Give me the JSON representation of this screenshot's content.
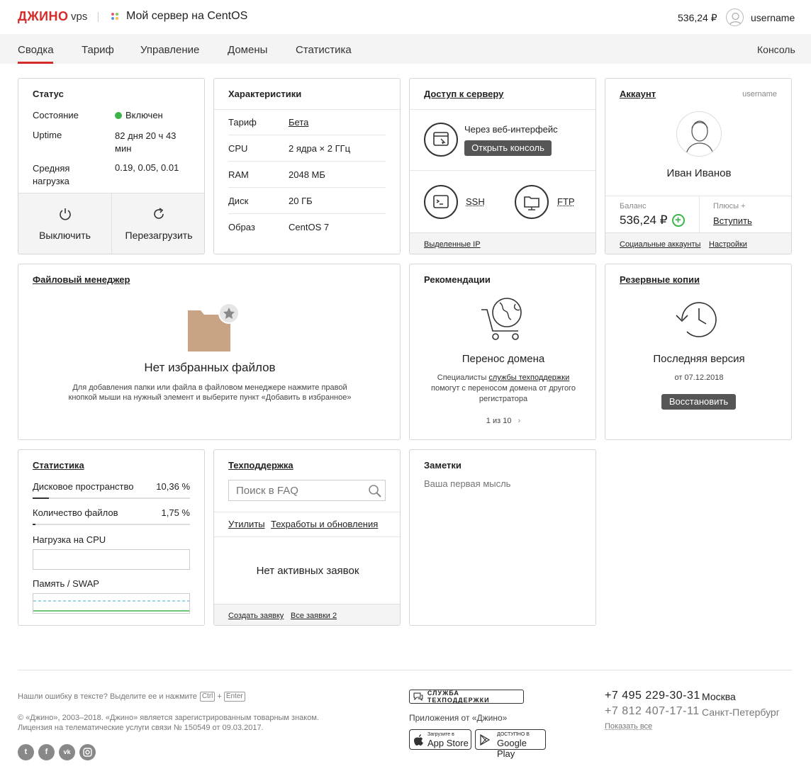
{
  "header": {
    "logo": "ДЖИНО",
    "product": "vps",
    "server_title": "Мой сервер на CentOS",
    "balance": "536,24 ₽",
    "username": "username"
  },
  "nav": {
    "tabs": [
      "Сводка",
      "Тариф",
      "Управление",
      "Домены",
      "Статистика"
    ],
    "console": "Консоль"
  },
  "status": {
    "title": "Статус",
    "state_label": "Состояние",
    "state_value": "Включен",
    "uptime_label": "Uptime",
    "uptime_value": "82 дня 20 ч 43 мин",
    "load_label": "Средняя нагрузка",
    "load_value": "0.19, 0.05, 0.01",
    "off_button": "Выключить",
    "reboot_button": "Перезагрузить",
    "state_color": "#3bb54a"
  },
  "specs": {
    "title": "Характеристики",
    "rows": [
      {
        "label": "Тариф",
        "value": "Бета"
      },
      {
        "label": "CPU",
        "value": "2 ядра × 2 ГГц"
      },
      {
        "label": "RAM",
        "value": "2048 МБ"
      },
      {
        "label": "Диск",
        "value": "20 ГБ"
      },
      {
        "label": "Образ",
        "value": "CentOS 7"
      }
    ]
  },
  "access": {
    "title": "Доступ к серверу",
    "web_label": "Через веб-интерфейс",
    "console_button": "Открыть консоль",
    "ssh": "SSH",
    "ftp": "FTP",
    "ips": "Выделенные IP"
  },
  "account": {
    "title": "Аккаунт",
    "username": "username",
    "name": "Иван Иванов",
    "balance_label": "Баланс",
    "balance_value": "536,24 ₽",
    "plus_label": "Плюсы +",
    "join": "Вступить",
    "social": "Социальные аккаунты",
    "settings": "Настройки"
  },
  "files": {
    "title": "Файловый менеджер",
    "empty_title": "Нет избранных файлов",
    "empty_text_1": "Для добавления папки или файла в файловом менеджере нажмите правой",
    "empty_text_2": "кнопкой мыши на нужный элемент и выберите пункт «Добавить в избранное»"
  },
  "recommend": {
    "title": "Рекомендации",
    "heading": "Перенос домена",
    "text_1": "Специалисты",
    "text_link": "службы техподдержки",
    "text_2": "помогут с переносом домена от другого",
    "text_3": "регистратора",
    "pager": "1 из 10"
  },
  "backup": {
    "title": "Резервные копии",
    "heading": "Последняя версия",
    "date": "от 07.12.2018",
    "restore": "Восстановить"
  },
  "stats": {
    "title": "Статистика",
    "disk_label": "Дисковое пространство",
    "disk_value": "10,36 %",
    "disk_fraction": 0.1036,
    "files_label": "Количество файлов",
    "files_value": "1,75 %",
    "files_fraction": 0.0175,
    "cpu_label": "Нагрузка на CPU",
    "mem_label": "Память / SWAP"
  },
  "support": {
    "title": "Техподдержка",
    "search_placeholder": "Поиск в FAQ",
    "utils": "Утилиты",
    "maintenance": "Техработы и обновления",
    "empty": "Нет активных заявок",
    "create": "Создать заявку",
    "all": "Все заявки 2"
  },
  "notes": {
    "title": "Заметки",
    "placeholder": "Ваша первая мысль"
  },
  "footer": {
    "error_text": "Нашли ошибку в тексте? Выделите ее и нажмите",
    "key_ctrl": "Ctrl",
    "plus": "+",
    "key_enter": "Enter",
    "copyright_1": "© «Джино», 2003–2018. «Джино» является зарегистрированным товарным знаком.",
    "copyright_2": "Лицензия на телематические услуги связи № 150549 от 09.03.2017.",
    "support_badge": "СЛУЖБА ТЕХПОДДЕРЖКИ",
    "apps_label": "Приложения от «Джино»",
    "appstore_small": "Загрузите в",
    "appstore": "App Store",
    "gplay_small": "ДОСТУПНО В",
    "gplay": "Google Play",
    "phone1": "+7 495 229-30-31",
    "city1": "Москва",
    "phone2": "+7 812 407-17-11",
    "city2": "Санкт-Петербург",
    "show_all": "Показать все"
  },
  "colors": {
    "brand": "#d62b2b",
    "green": "#3bb54a"
  }
}
